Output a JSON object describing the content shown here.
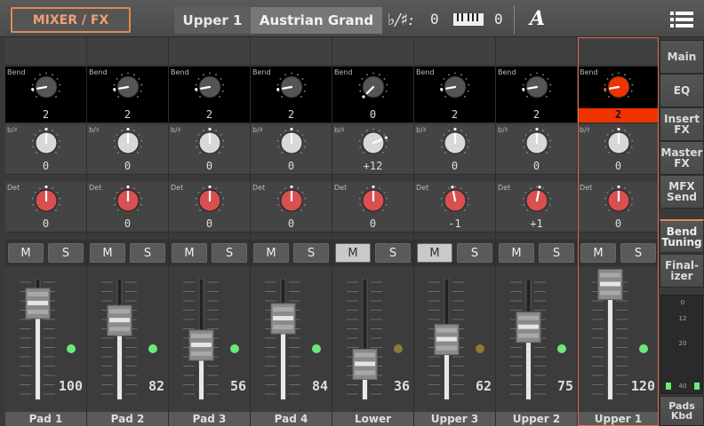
{
  "header": {
    "title": "MIXER / FX",
    "part": "Upper 1",
    "sound": "Austrian Grand",
    "transpose_label": "♭/♯:",
    "transpose_value": "0",
    "keyboard_value": "0",
    "performance_icon": "A",
    "menu_icon": "menu-icon"
  },
  "row_labels": {
    "bend": "Bend",
    "tuning": "b/♯",
    "detune": "Det"
  },
  "channels": [
    {
      "name": "Pad 1",
      "bend": "2",
      "tuning": "0",
      "detune": "0",
      "volume": "100",
      "mute": false,
      "solo": false,
      "led": "green",
      "selected": false
    },
    {
      "name": "Pad 2",
      "bend": "2",
      "tuning": "0",
      "detune": "0",
      "volume": "82",
      "mute": false,
      "solo": false,
      "led": "green",
      "selected": false
    },
    {
      "name": "Pad 3",
      "bend": "2",
      "tuning": "0",
      "detune": "0",
      "volume": "56",
      "mute": false,
      "solo": false,
      "led": "green",
      "selected": false
    },
    {
      "name": "Pad 4",
      "bend": "2",
      "tuning": "0",
      "detune": "0",
      "volume": "84",
      "mute": false,
      "solo": false,
      "led": "green",
      "selected": false
    },
    {
      "name": "Lower",
      "bend": "0",
      "tuning": "+12",
      "detune": "0",
      "volume": "36",
      "mute": true,
      "solo": false,
      "led": "dim",
      "selected": false
    },
    {
      "name": "Upper 3",
      "bend": "2",
      "tuning": "0",
      "detune": "-1",
      "volume": "62",
      "mute": true,
      "solo": false,
      "led": "dim",
      "selected": false
    },
    {
      "name": "Upper 2",
      "bend": "2",
      "tuning": "0",
      "detune": "+1",
      "volume": "75",
      "mute": false,
      "solo": false,
      "led": "green",
      "selected": false
    },
    {
      "name": "Upper 1",
      "bend": "2",
      "tuning": "0",
      "detune": "0",
      "volume": "120",
      "mute": false,
      "solo": false,
      "led": "green",
      "selected": true
    }
  ],
  "ms_labels": {
    "mute": "M",
    "solo": "S"
  },
  "sidebar": {
    "items": [
      {
        "label": "Main",
        "active": false
      },
      {
        "label": "EQ",
        "active": false
      },
      {
        "label": "Insert FX",
        "active": false
      },
      {
        "label": "Master FX",
        "active": false
      },
      {
        "label": "MFX Send",
        "active": false
      },
      {
        "label": "Bend Tuning",
        "active": true
      },
      {
        "label": "Final-izer",
        "active": false
      }
    ],
    "meter_ticks": [
      "0",
      "12",
      "20",
      "40"
    ],
    "pads_kbd": "Pads Kbd"
  },
  "colors": {
    "accent": "#e08a50",
    "selected": "#ee3300",
    "led_on": "#6ee87a",
    "led_dim": "#8a7a3a",
    "detune_knob": "#d85050"
  }
}
